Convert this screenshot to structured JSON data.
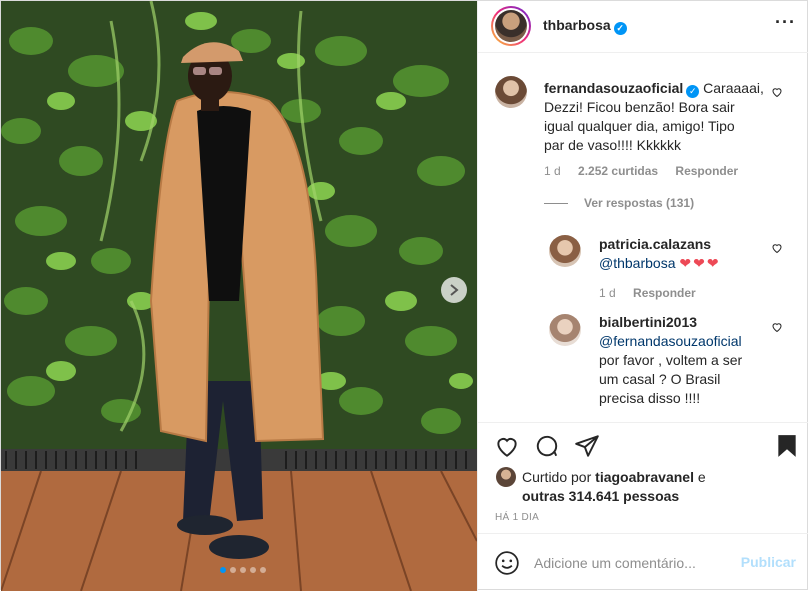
{
  "post": {
    "author": "thbarbosa",
    "verified": true,
    "more_icon": "more-horizontal-icon"
  },
  "comments": [
    {
      "username": "fernandasouzaoficial",
      "verified": true,
      "text": "Caraaaai, Dezzi! Ficou benzão! Bora sair igual qualquer dia, amigo! Tipo par de vaso!!!! Kkkkkk",
      "line1": "Caraaaai,",
      "line2": "Dezzi! Ficou benzão! Bora sair",
      "line3": "igual qualquer dia, amigo! Tipo",
      "line4": "par de vaso!!!! Kkkkkk",
      "age": "1 d",
      "likes": "2.252 curtidas",
      "reply": "Responder",
      "view_replies": "Ver respostas (131)"
    }
  ],
  "replies": [
    {
      "username": "patricia.calazans",
      "mention": "@thbarbosa",
      "hearts": "❤❤❤",
      "age": "1 d",
      "reply": "Responder"
    },
    {
      "username": "bialbertini2013",
      "mention": "@fernandasouzaoficial",
      "line1": "por favor , voltem a ser",
      "line2": "um casal ? O Brasil",
      "line3": "precisa disso !!!!"
    }
  ],
  "likes": {
    "prefix": "Curtido por",
    "liker": "tiagoabravanel",
    "joiner": "e",
    "others": "outras 314.641 pessoas"
  },
  "timestamp": "HÁ 1 DIA",
  "add_comment": {
    "placeholder": "Adicione um comentário...",
    "publish": "Publicar"
  },
  "colors": {
    "link": "#00376b",
    "verified": "#0095f6",
    "meta": "#8e8e8e",
    "publish_disabled": "#b2dffc",
    "hearts": "#ed4956"
  }
}
